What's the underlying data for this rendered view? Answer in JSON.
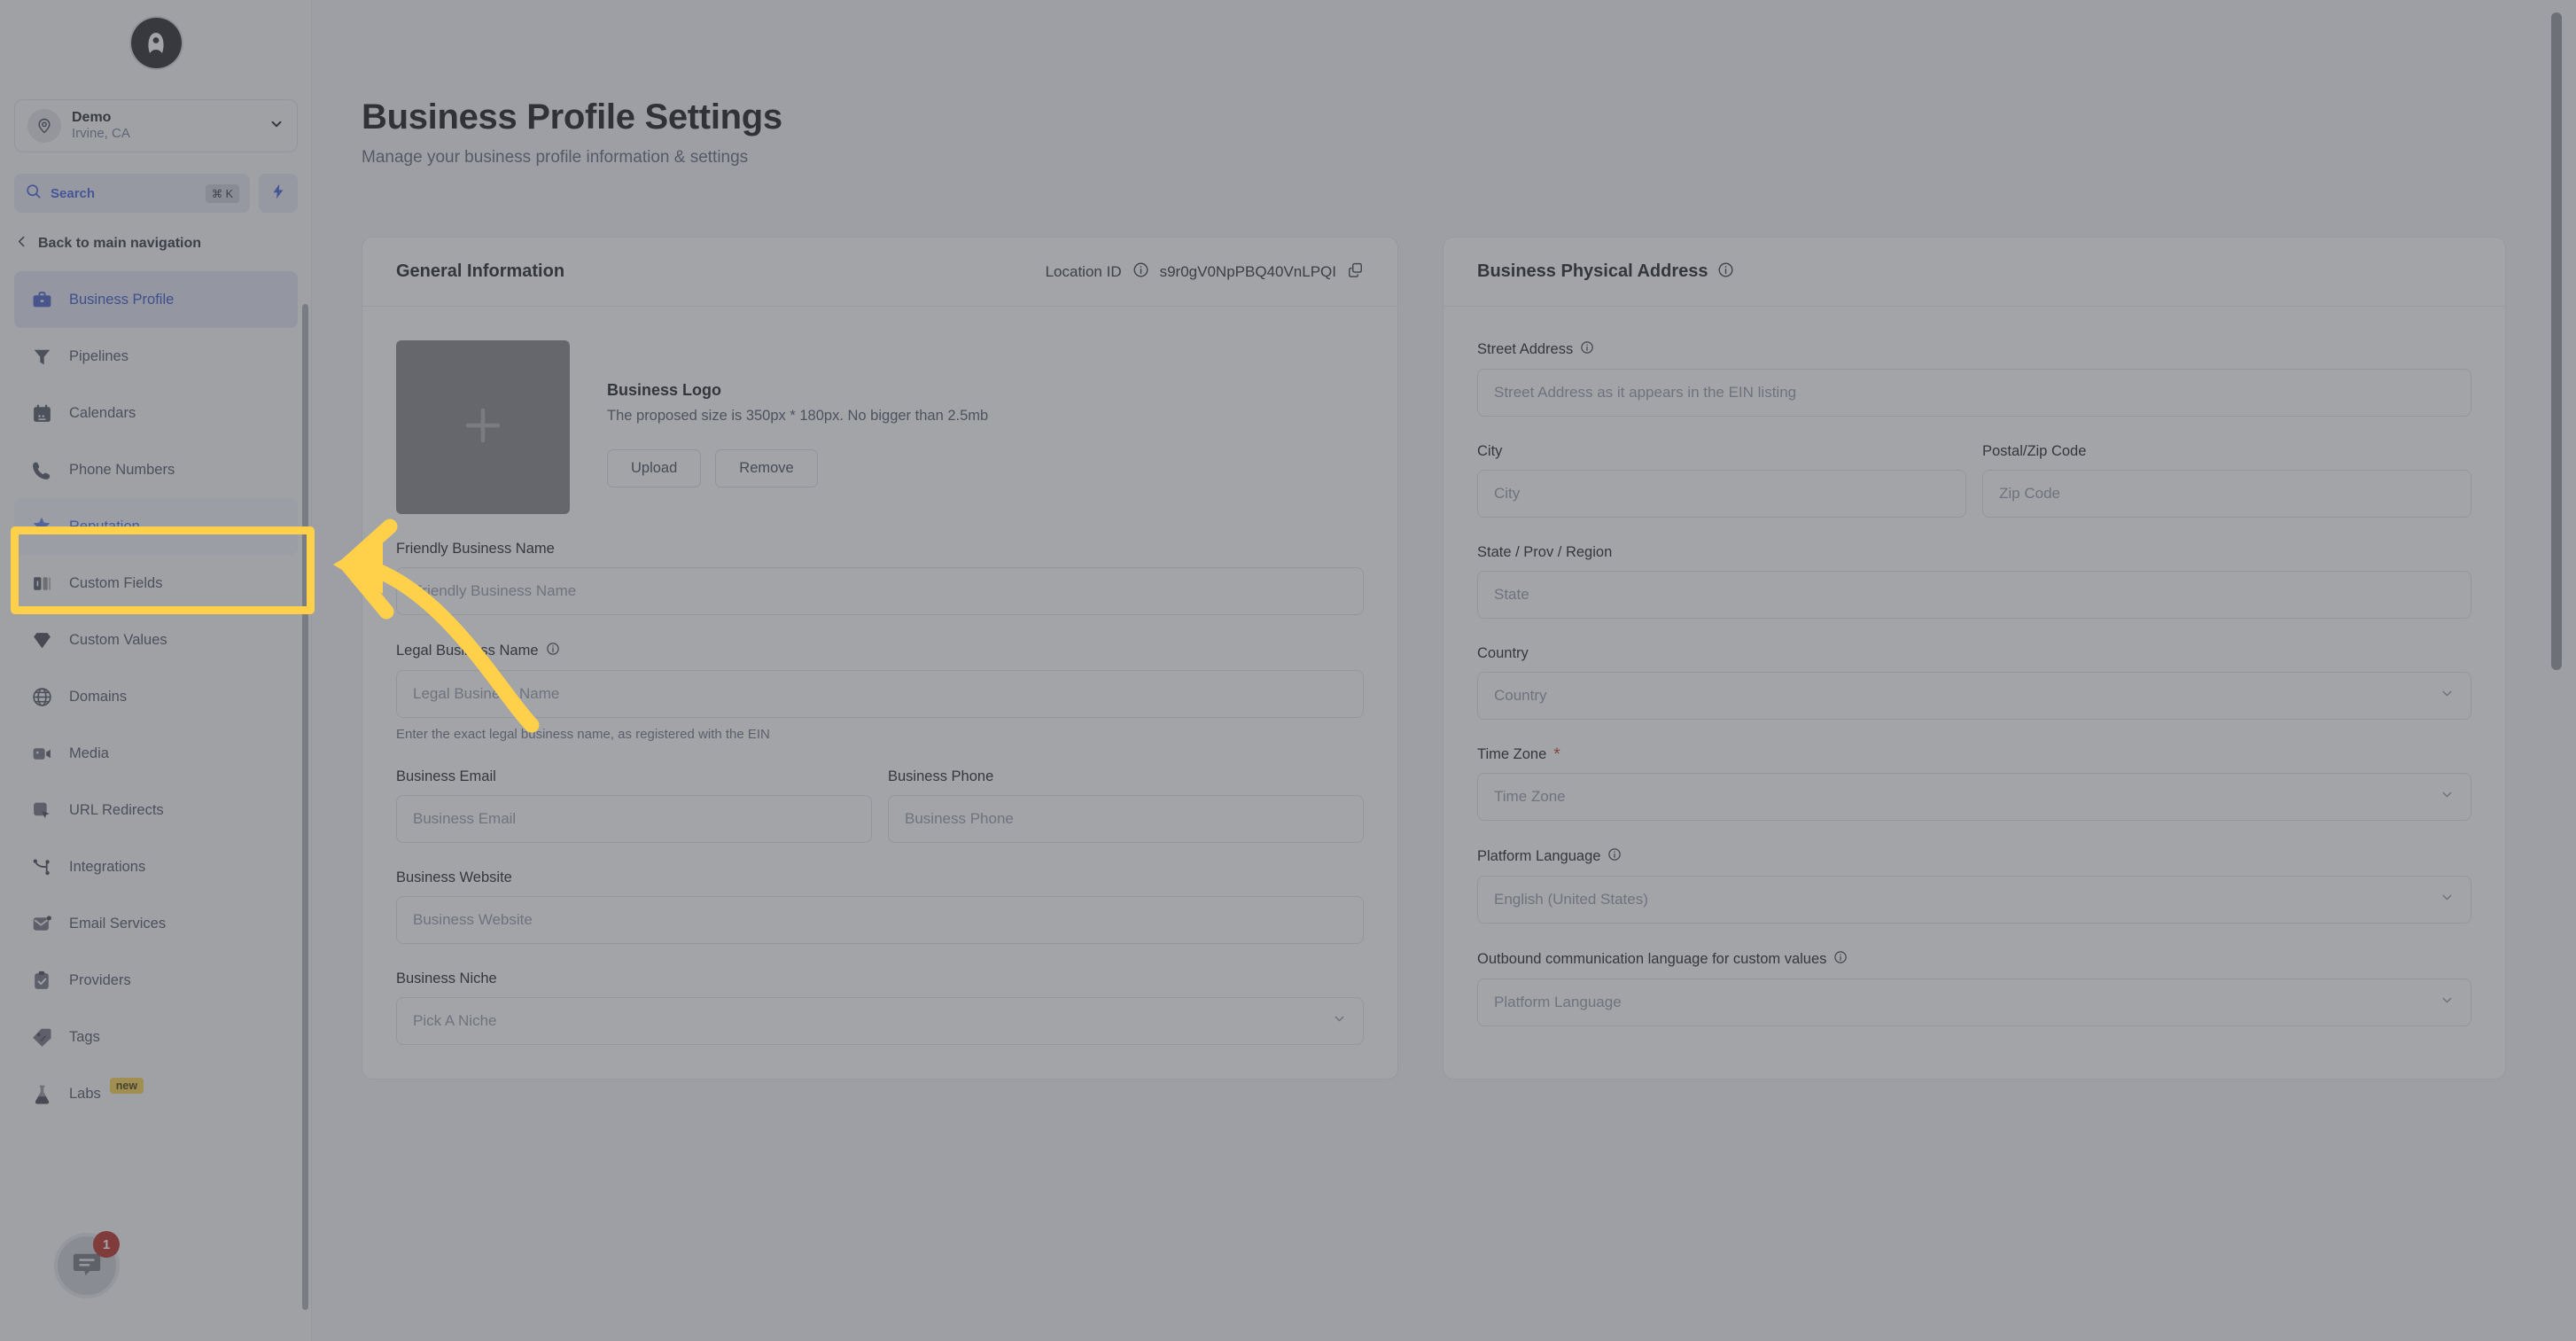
{
  "sidebar": {
    "logo_glyph": "A",
    "location": {
      "name": "Demo",
      "sub": "Irvine, CA"
    },
    "search": {
      "label": "Search",
      "shortcut": "⌘ K"
    },
    "back_label": "Back to main navigation",
    "items": [
      {
        "label": "Business Profile",
        "icon": "briefcase-icon",
        "state": "active"
      },
      {
        "label": "Pipelines",
        "icon": "funnel-icon",
        "state": "normal"
      },
      {
        "label": "Calendars",
        "icon": "calendar-icon",
        "state": "normal"
      },
      {
        "label": "Phone Numbers",
        "icon": "phone-icon",
        "state": "normal"
      },
      {
        "label": "Reputation",
        "icon": "star-sparkle-icon",
        "state": "highlighted"
      },
      {
        "label": "Custom Fields",
        "icon": "custom-fields-icon",
        "state": "normal"
      },
      {
        "label": "Custom Values",
        "icon": "diamond-icon",
        "state": "normal"
      },
      {
        "label": "Domains",
        "icon": "globe-icon",
        "state": "normal"
      },
      {
        "label": "Media",
        "icon": "video-camera-icon",
        "state": "normal"
      },
      {
        "label": "URL Redirects",
        "icon": "cursor-square-icon",
        "state": "normal"
      },
      {
        "label": "Integrations",
        "icon": "nodes-icon",
        "state": "normal"
      },
      {
        "label": "Email Services",
        "icon": "envelope-icon",
        "state": "normal"
      },
      {
        "label": "Providers",
        "icon": "clipboard-check-icon",
        "state": "normal"
      },
      {
        "label": "Tags",
        "icon": "tag-icon",
        "state": "normal"
      },
      {
        "label": "Labs",
        "icon": "flask-icon",
        "state": "normal",
        "badge": "new"
      }
    ],
    "chat_badge_count": "1"
  },
  "header": {
    "title": "Business Profile Settings",
    "subtitle": "Manage your business profile information & settings"
  },
  "general_card": {
    "title": "General Information",
    "location_id_label": "Location ID",
    "location_id_value": "s9r0gV0NpPBQ40VnLPQI",
    "logo": {
      "title": "Business Logo",
      "description": "The proposed size is 350px * 180px. No bigger than 2.5mb",
      "upload_label": "Upload",
      "remove_label": "Remove"
    },
    "fields": {
      "friendly_name": {
        "label": "Friendly Business Name",
        "placeholder": "Friendly Business Name",
        "value": ""
      },
      "legal_name": {
        "label": "Legal Business Name",
        "placeholder": "Legal Business Name",
        "value": "",
        "helper": "Enter the exact legal business name, as registered with the EIN"
      },
      "business_email": {
        "label": "Business Email",
        "placeholder": "Business Email",
        "value": ""
      },
      "business_phone": {
        "label": "Business Phone",
        "placeholder": "Business Phone",
        "value": ""
      },
      "business_website": {
        "label": "Business Website",
        "placeholder": "Business Website",
        "value": ""
      },
      "business_niche": {
        "label": "Business Niche",
        "placeholder": "Pick A Niche",
        "value": ""
      }
    }
  },
  "address_card": {
    "title": "Business Physical Address",
    "fields": {
      "street": {
        "label": "Street Address",
        "placeholder": "Street Address as it appears in the EIN listing",
        "value": ""
      },
      "city": {
        "label": "City",
        "placeholder": "City",
        "value": ""
      },
      "postal": {
        "label": "Postal/Zip Code",
        "placeholder": "Zip Code",
        "value": ""
      },
      "state": {
        "label": "State / Prov / Region",
        "placeholder": "State",
        "value": ""
      },
      "country": {
        "label": "Country",
        "placeholder": "Country",
        "value": ""
      },
      "timezone": {
        "label": "Time Zone",
        "required_mark": "*",
        "placeholder": "Time Zone",
        "value": ""
      },
      "platform_language": {
        "label": "Platform Language",
        "placeholder": "English (United States)",
        "value": ""
      },
      "outbound_language": {
        "label": "Outbound communication language for custom values",
        "placeholder": "Platform Language",
        "value": ""
      }
    }
  },
  "annotations": {
    "highlight_color": "#ffd04a",
    "highlight_target": "Reputation",
    "arrow_color": "#ffd04a",
    "arrow_direction": "left"
  }
}
